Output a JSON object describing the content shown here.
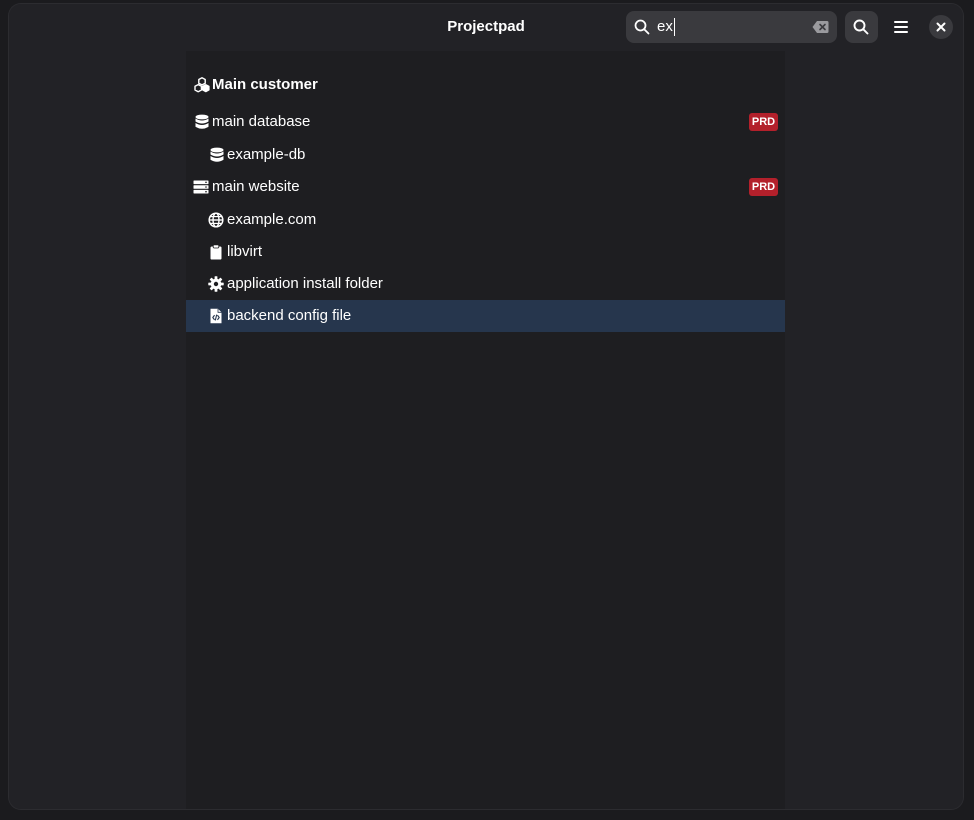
{
  "window": {
    "title": "Projectpad"
  },
  "search": {
    "value": "ex",
    "placeholder": ""
  },
  "tree": {
    "project": "Main customer",
    "items": [
      {
        "label": "main database",
        "badge": "PRD",
        "icon": "database-icon"
      },
      {
        "label": "example-db",
        "icon": "database-icon"
      },
      {
        "label": "main website",
        "badge": "PRD",
        "icon": "server-icon"
      },
      {
        "label": "example.com",
        "icon": "globe-icon"
      },
      {
        "label": "libvirt",
        "icon": "clipboard-icon"
      },
      {
        "label": "application install folder",
        "icon": "gear-icon"
      },
      {
        "label": "backend config file",
        "icon": "code-file-icon",
        "selected": true
      }
    ]
  },
  "colors": {
    "accent_selection": "#26364d",
    "badge_prd": "#b3202b"
  }
}
